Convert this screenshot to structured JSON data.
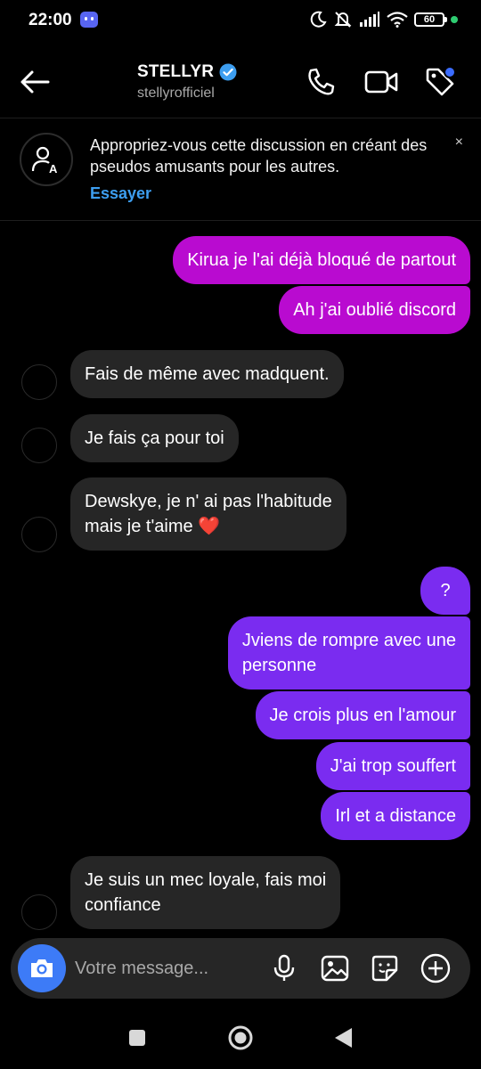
{
  "status_bar": {
    "time": "22:00",
    "battery": "60"
  },
  "header": {
    "name": "STELLYR",
    "handle": "stellyrofficiel"
  },
  "banner": {
    "text": "Appropriez-vous cette discussion en créant des pseudos amusants pour les autres.",
    "action": "Essayer",
    "close": "×"
  },
  "messages": [
    {
      "side": "out",
      "text": "Kirua je l'ai déjà bloqué de partout"
    },
    {
      "side": "out",
      "text": "Ah j'ai oublié discord"
    },
    {
      "side": "in",
      "text": "Fais de même avec madquent."
    },
    {
      "side": "in",
      "text": "Je fais ça pour toi"
    },
    {
      "side": "in",
      "line1": "Dewskye, je n' ai pas l'habitude",
      "line2": "mais je t'aime ❤️"
    },
    {
      "side": "out",
      "text": "?"
    },
    {
      "side": "out",
      "line1": "Jviens de rompre avec une",
      "line2": "personne"
    },
    {
      "side": "out",
      "text": "Je crois plus en l'amour"
    },
    {
      "side": "out",
      "text": "J'ai trop souffert"
    },
    {
      "side": "out",
      "text": "Irl et a distance"
    },
    {
      "side": "in",
      "line1": "Je suis un mec loyale, fais moi",
      "line2": "confiance"
    }
  ],
  "composer": {
    "placeholder": "Votre message..."
  },
  "colors": {
    "outgoing_magenta": "#b90bd0",
    "outgoing_purple": "#7a2cf0",
    "incoming": "#262626",
    "accent_blue": "#3d9ef0",
    "camera_blue": "#3d7bf7"
  }
}
